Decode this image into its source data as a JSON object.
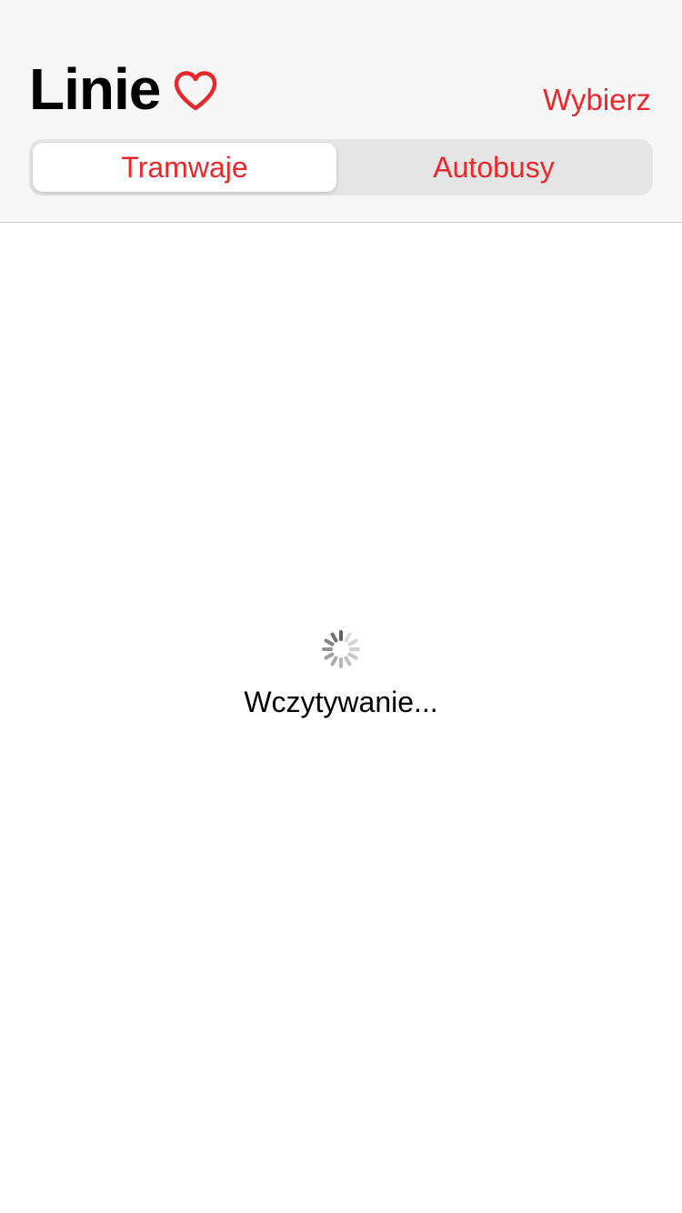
{
  "header": {
    "title": "Linie",
    "favorite_icon": "heart-outline-icon",
    "select_label": "Wybierz"
  },
  "segments": [
    {
      "label": "Tramwaje",
      "selected": true
    },
    {
      "label": "Autobusy",
      "selected": false
    }
  ],
  "loading": {
    "icon": "activity-spinner-icon",
    "text": "Wczytywanie..."
  },
  "colors": {
    "accent": "#e8282c",
    "header_bg": "#f7f7f7",
    "segment_track": "#e5e5e5",
    "background": "#ffffff"
  }
}
